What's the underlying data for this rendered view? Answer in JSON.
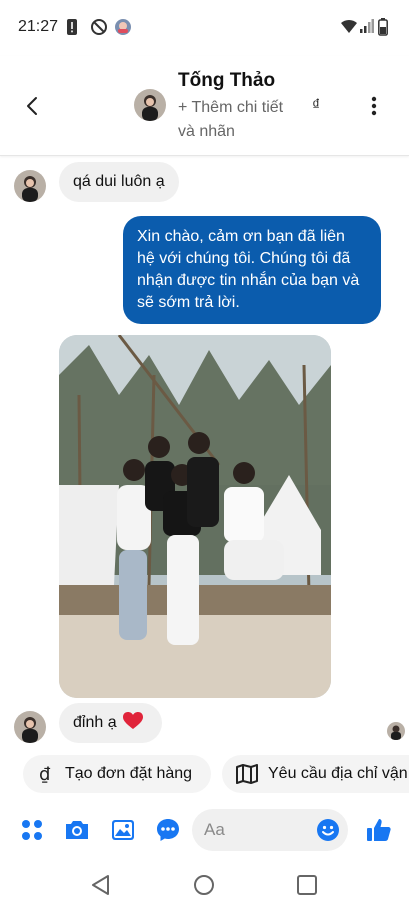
{
  "status_bar": {
    "time": "21:27",
    "icons": [
      "alert-icon",
      "blocked-icon",
      "app-icon",
      "wifi-icon",
      "signal-icon",
      "battery-icon"
    ]
  },
  "header": {
    "contact_name": "Tống Thảo",
    "subtitle": "+ Thêm chi tiết và nhãn",
    "currency_symbol": "₫"
  },
  "messages": [
    {
      "direction": "incoming",
      "text": "qá dui luôn ạ"
    },
    {
      "direction": "outgoing",
      "text": "Xin chào, cảm ơn bạn đã liên hệ với chúng tôi. Chúng tôi đã nhận được tin nhắn của bạn và sẽ sớm trả lời."
    },
    {
      "direction": "incoming",
      "type": "photo"
    },
    {
      "direction": "incoming",
      "text": "đỉnh ạ",
      "emoji": "red-heart"
    }
  ],
  "quick_actions": [
    {
      "icon": "dong-icon",
      "label": "Tạo đơn đặt hàng"
    },
    {
      "icon": "map-icon",
      "label": "Yêu cầu địa chỉ vận"
    }
  ],
  "composer": {
    "placeholder": "Aa"
  },
  "colors": {
    "accent": "#1877f2",
    "outgoing_bubble": "#0b5cad",
    "incoming_bubble": "#f0f0f0",
    "heart": "#e0243a"
  }
}
